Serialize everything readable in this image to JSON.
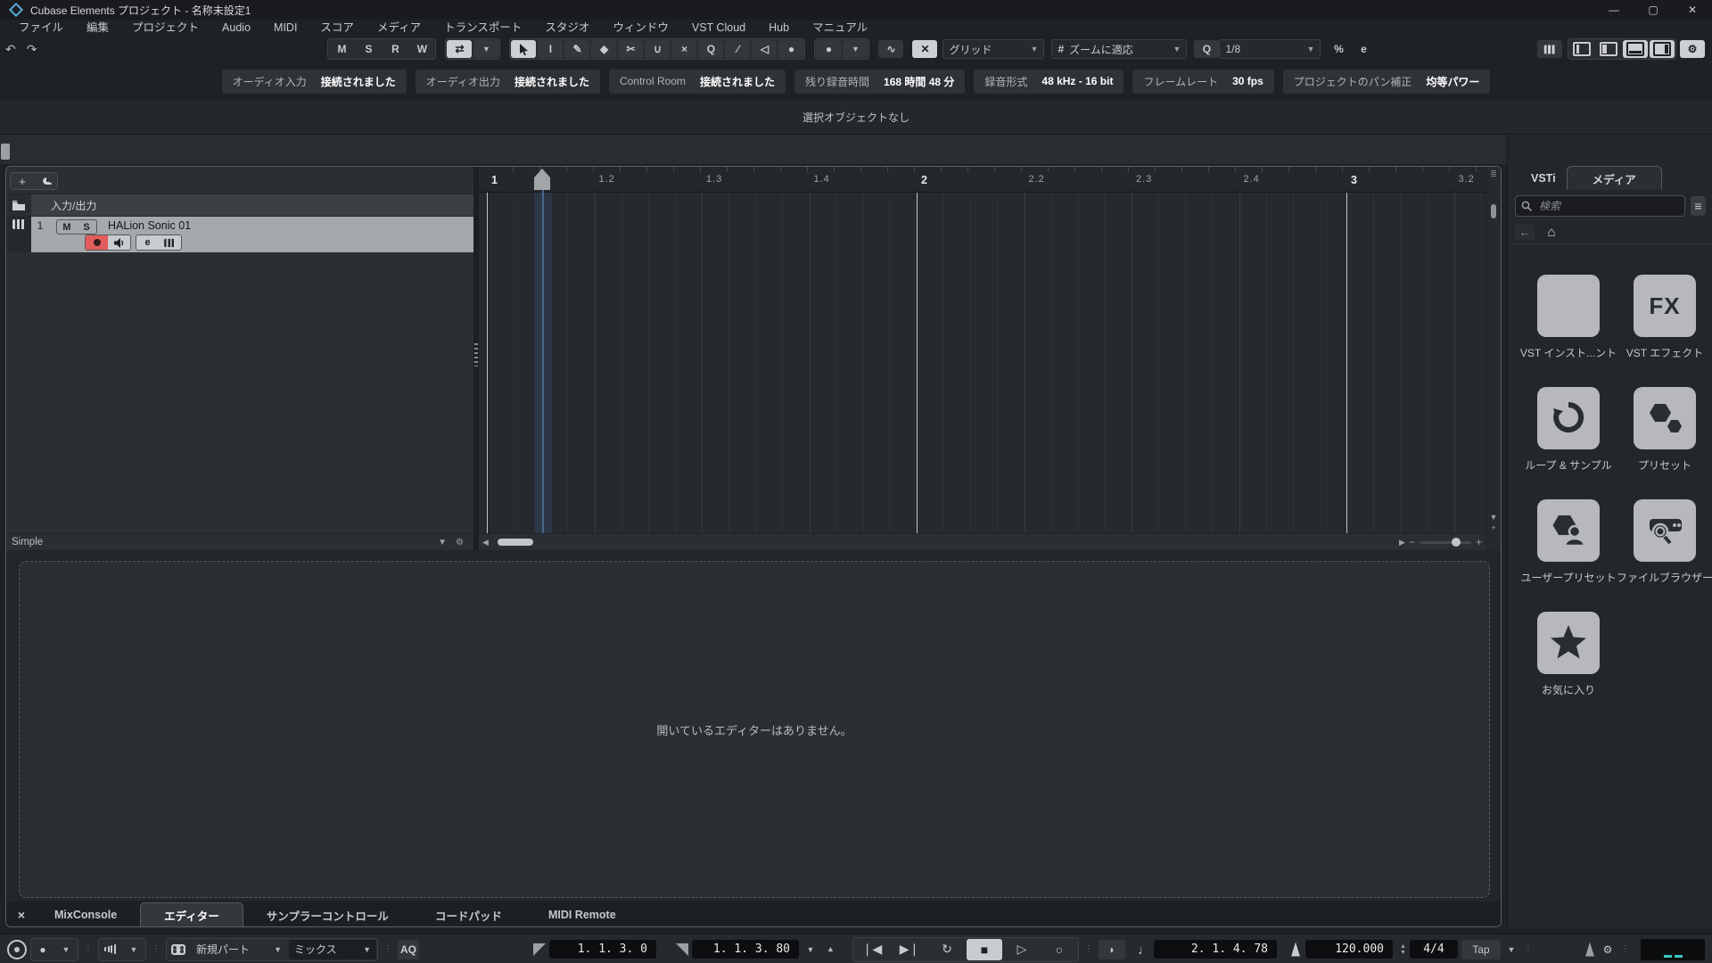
{
  "titlebar": {
    "title": "Cubase Elements プロジェクト - 名称未設定1"
  },
  "menubar": {
    "items": [
      "ファイル",
      "編集",
      "プロジェクト",
      "Audio",
      "MIDI",
      "スコア",
      "メディア",
      "トランスポート",
      "スタジオ",
      "ウィンドウ",
      "VST Cloud",
      "Hub",
      "マニュアル"
    ]
  },
  "toolbar": {
    "automation": [
      "M",
      "S",
      "R",
      "W"
    ],
    "grid_label": "グリッド",
    "grid_type_icon": "#",
    "grid_type_label": "ズームに適応",
    "quantize_icon": "Q",
    "quantize_label": "1/8",
    "quantize_apply_label": "%",
    "quantize_edit_label": "e"
  },
  "infoline": {
    "badges": [
      {
        "label": "オーディオ入力",
        "value": "接続されました"
      },
      {
        "label": "オーディオ出力",
        "value": "接続されました"
      },
      {
        "label": "Control Room",
        "value": "接続されました"
      },
      {
        "label": "残り録音時間",
        "value": "168 時間 48 分"
      },
      {
        "label": "録音形式",
        "value": "48 kHz - 16 bit"
      },
      {
        "label": "フレームレート",
        "value": "30 fps"
      },
      {
        "label": "プロジェクトのパン補正",
        "value": "均等パワー"
      }
    ]
  },
  "status": {
    "selection": "選択オブジェクトなし"
  },
  "tracklist": {
    "io_folder": "入力/出力",
    "track": {
      "number": "1",
      "mute": "M",
      "solo": "S",
      "name": "HALion Sonic 01",
      "edit": "e"
    },
    "footer": "Simple"
  },
  "ruler": {
    "labels": [
      "1",
      "1.2",
      "1.3",
      "1.4",
      "2",
      "2.2",
      "2.3",
      "2.4",
      "3",
      "3.2"
    ]
  },
  "rightzone": {
    "tabs": [
      "VSTi",
      "メディア"
    ],
    "active_tab": "メディア",
    "search_placeholder": "検索",
    "tiles": [
      {
        "icon": "piano",
        "label": "VST インスト...ント"
      },
      {
        "icon": "fx",
        "label": "VST エフェクト"
      },
      {
        "icon": "loop",
        "label": "ループ & サンプル"
      },
      {
        "icon": "hexagons",
        "label": "プリセット"
      },
      {
        "icon": "user-preset",
        "label": "ユーザープリセット"
      },
      {
        "icon": "file-browser",
        "label": "ファイルブラウザー"
      },
      {
        "icon": "star",
        "label": "お気に入り"
      }
    ]
  },
  "lowerzone": {
    "empty_message": "開いているエディターはありません。",
    "close_icon": "×",
    "tabs": [
      "MixConsole",
      "エディター",
      "サンプラーコントロール",
      "コードパッド",
      "MIDI Remote"
    ],
    "active_tab": "エディター"
  },
  "transport": {
    "insert_part_label": "新規パート",
    "mix_label": "ミックス",
    "aq_label": "AQ",
    "left_locator": "1. 1. 3.  0",
    "right_locator": "1. 1. 3. 80",
    "secondary_position": "2. 1. 4. 78",
    "tempo": "120.000",
    "time_signature": "4/4",
    "tap_label": "Tap"
  }
}
